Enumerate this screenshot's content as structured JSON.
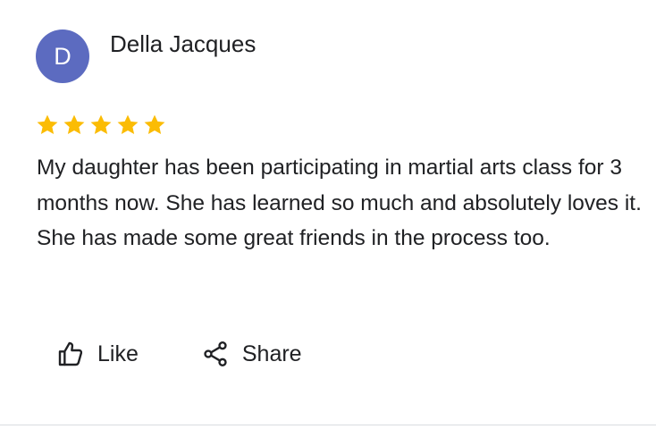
{
  "review": {
    "avatar_letter": "D",
    "avatar_color": "#5c6bc0",
    "reviewer_name": "Della Jacques",
    "rating": 5,
    "rating_max": 5,
    "star_color": "#fbbc04",
    "text": "My daughter has been participating in martial arts class for 3 months now. She has learned so much and absolutely loves it. She has made some great friends in the process too."
  },
  "actions": {
    "like": {
      "label": "Like",
      "icon": "thumbs-up-icon"
    },
    "share": {
      "label": "Share",
      "icon": "share-icon"
    }
  }
}
